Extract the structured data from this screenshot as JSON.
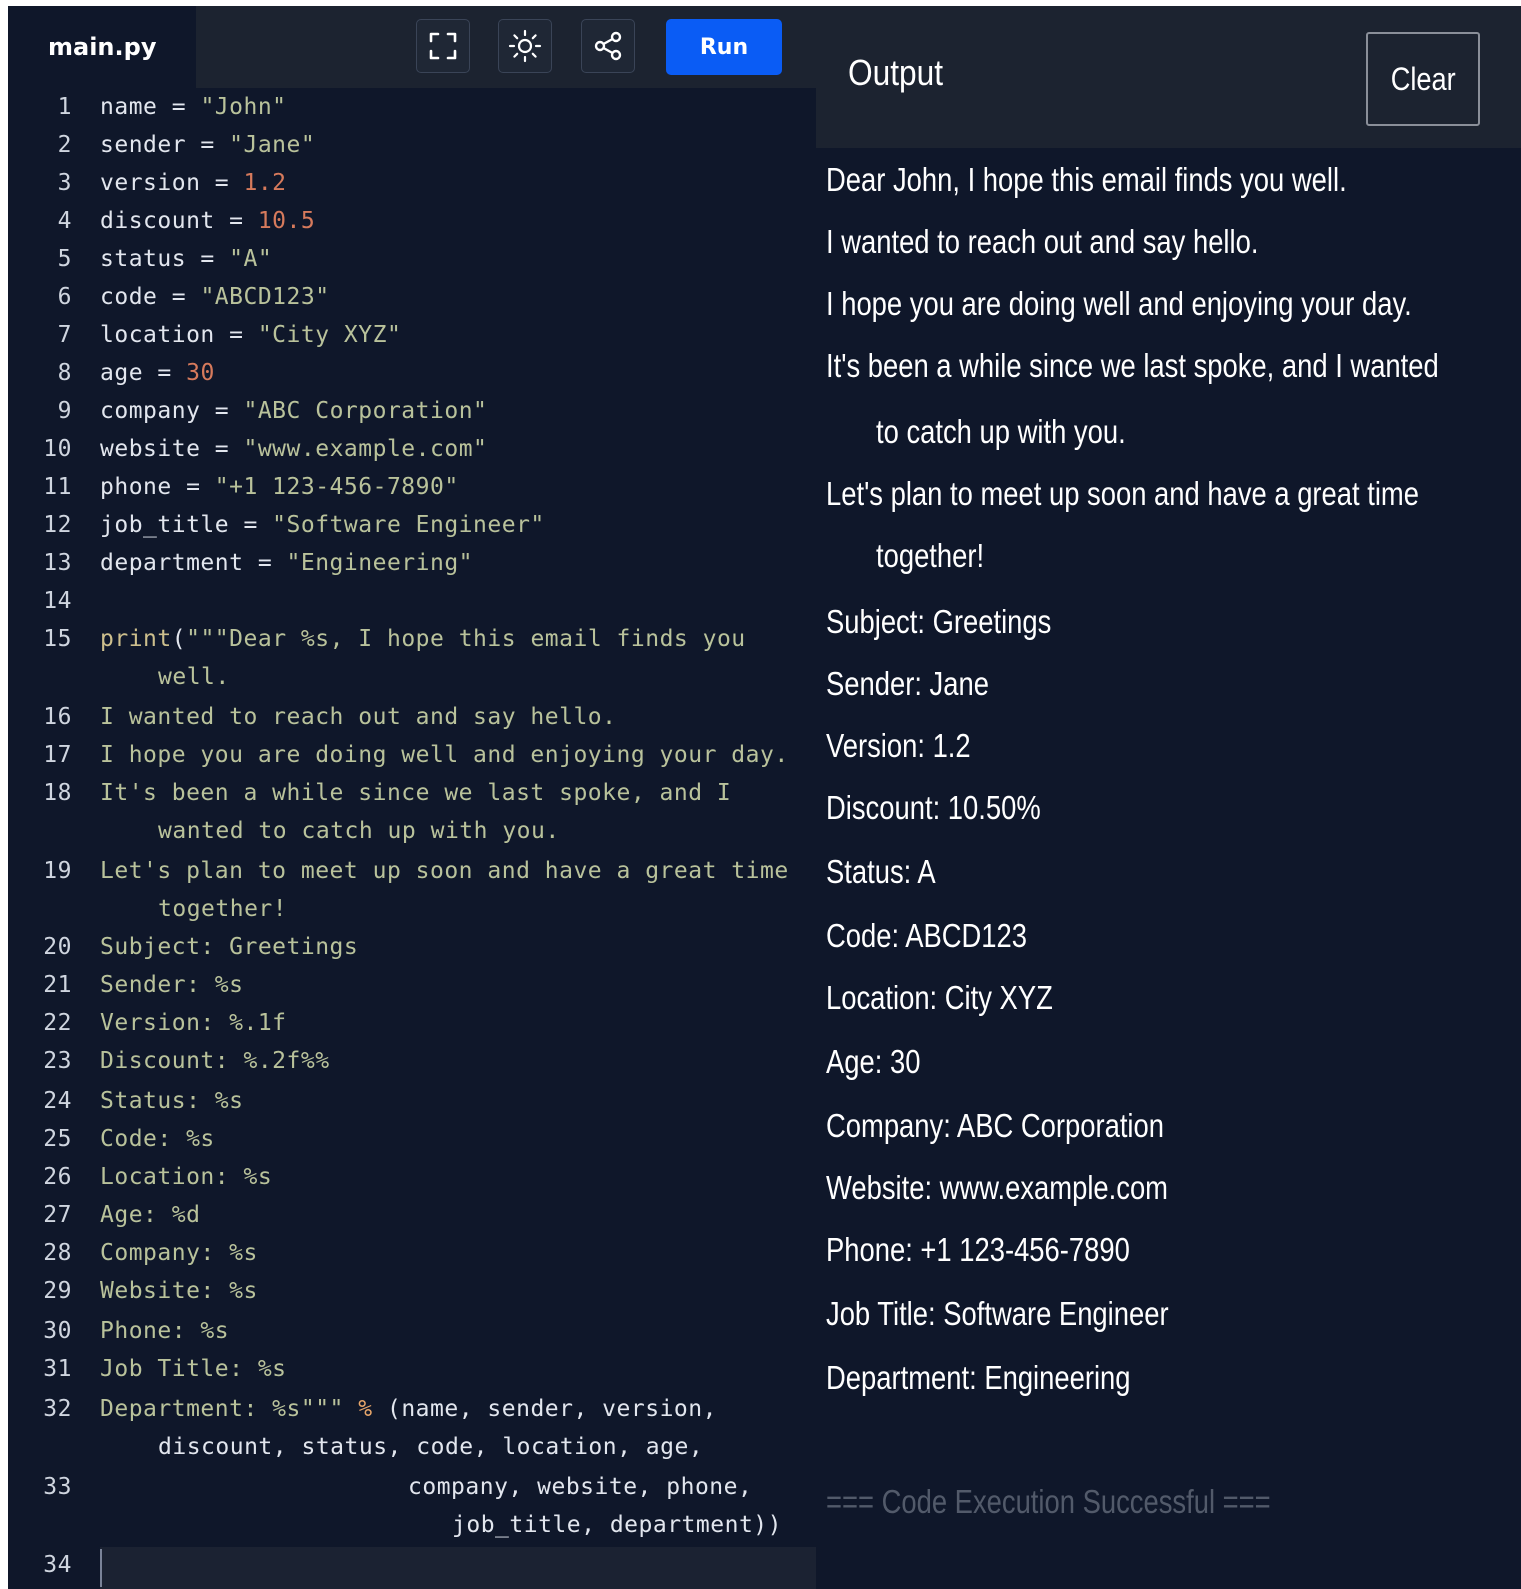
{
  "editor": {
    "file_name": "main.py",
    "toolbar": {
      "fullscreen_icon": "fullscreen-icon",
      "theme_icon": "sun-icon",
      "share_icon": "share-icon",
      "run_label": "Run"
    },
    "accent_color": "#0a5cf5",
    "lines": [
      {
        "n": "1",
        "segs": [
          [
            "",
            "name = "
          ],
          [
            "str",
            "\"John\""
          ]
        ]
      },
      {
        "n": "2",
        "segs": [
          [
            "",
            "sender = "
          ],
          [
            "str",
            "\"Jane\""
          ]
        ]
      },
      {
        "n": "3",
        "segs": [
          [
            "",
            "version = "
          ],
          [
            "num",
            "1.2"
          ]
        ]
      },
      {
        "n": "4",
        "segs": [
          [
            "",
            "discount = "
          ],
          [
            "num",
            "10.5"
          ]
        ]
      },
      {
        "n": "5",
        "segs": [
          [
            "",
            "status = "
          ],
          [
            "str",
            "\"A\""
          ]
        ]
      },
      {
        "n": "6",
        "segs": [
          [
            "",
            "code = "
          ],
          [
            "str",
            "\"ABCD123\""
          ]
        ]
      },
      {
        "n": "7",
        "segs": [
          [
            "",
            "location = "
          ],
          [
            "str",
            "\"City XYZ\""
          ]
        ]
      },
      {
        "n": "8",
        "segs": [
          [
            "",
            "age = "
          ],
          [
            "num",
            "30"
          ]
        ]
      },
      {
        "n": "9",
        "segs": [
          [
            "",
            "company = "
          ],
          [
            "str",
            "\"ABC Corporation\""
          ]
        ]
      },
      {
        "n": "10",
        "segs": [
          [
            "",
            "website = "
          ],
          [
            "str",
            "\"www.example.com\""
          ]
        ]
      },
      {
        "n": "11",
        "segs": [
          [
            "",
            "phone = "
          ],
          [
            "str",
            "\"+1 123-456-7890\""
          ]
        ]
      },
      {
        "n": "12",
        "segs": [
          [
            "",
            "job_title = "
          ],
          [
            "str",
            "\"Software Engineer\""
          ]
        ]
      },
      {
        "n": "13",
        "segs": [
          [
            "",
            "department = "
          ],
          [
            "str",
            "\"Engineering\""
          ]
        ]
      },
      {
        "n": "14",
        "segs": []
      },
      {
        "n": "15",
        "segs": [
          [
            "kw",
            "print"
          ],
          [
            "",
            "("
          ],
          [
            "str",
            "\"\"\"Dear %s, I hope this email finds you"
          ]
        ]
      },
      {
        "n": "",
        "indent": true,
        "segs": [
          [
            "str",
            "well."
          ]
        ]
      },
      {
        "n": "16",
        "segs": [
          [
            "str",
            "I wanted to reach out and say hello."
          ]
        ]
      },
      {
        "n": "17",
        "segs": [
          [
            "str",
            "I hope you are doing well and enjoying your day."
          ]
        ]
      },
      {
        "n": "18",
        "segs": [
          [
            "str",
            "It's been a while since we last spoke, and I"
          ]
        ]
      },
      {
        "n": "",
        "indent": true,
        "segs": [
          [
            "str",
            "wanted to catch up with you."
          ]
        ]
      },
      {
        "n": "19",
        "segs": [
          [
            "str",
            "Let's plan to meet up soon and have a great time"
          ]
        ]
      },
      {
        "n": "",
        "indent": true,
        "segs": [
          [
            "str",
            "together!"
          ]
        ]
      },
      {
        "n": "20",
        "segs": [
          [
            "str",
            "Subject: Greetings"
          ]
        ]
      },
      {
        "n": "21",
        "segs": [
          [
            "str",
            "Sender: %s"
          ]
        ]
      },
      {
        "n": "22",
        "segs": [
          [
            "str",
            "Version: %.1f"
          ]
        ]
      },
      {
        "n": "23",
        "segs": [
          [
            "str",
            "Discount: %.2f%%"
          ]
        ]
      },
      {
        "n": "24",
        "segs": [
          [
            "str",
            "Status: %s"
          ]
        ]
      },
      {
        "n": "25",
        "segs": [
          [
            "str",
            "Code: %s"
          ]
        ]
      },
      {
        "n": "26",
        "segs": [
          [
            "str",
            "Location: %s"
          ]
        ]
      },
      {
        "n": "27",
        "segs": [
          [
            "str",
            "Age: %d"
          ]
        ]
      },
      {
        "n": "28",
        "segs": [
          [
            "str",
            "Company: %s"
          ]
        ]
      },
      {
        "n": "29",
        "segs": [
          [
            "str",
            "Website: %s"
          ]
        ]
      },
      {
        "n": "30",
        "segs": [
          [
            "str",
            "Phone: %s"
          ]
        ]
      },
      {
        "n": "31",
        "segs": [
          [
            "str",
            "Job Title: %s"
          ]
        ]
      },
      {
        "n": "32",
        "segs": [
          [
            "str",
            "Department: %s\"\"\""
          ],
          [
            "",
            " "
          ],
          [
            "op",
            "%"
          ],
          [
            "",
            " (name, sender, version,"
          ]
        ]
      },
      {
        "n": "",
        "indent": true,
        "segs": [
          [
            "",
            "discount, status, code, location, age,"
          ]
        ]
      },
      {
        "n": "33",
        "deep": 1,
        "segs": [
          [
            "",
            "company, website, phone,"
          ]
        ]
      },
      {
        "n": "",
        "deep": 2,
        "segs": [
          [
            "",
            "job_title, department))"
          ]
        ]
      },
      {
        "n": "34",
        "segs": []
      }
    ]
  },
  "output": {
    "title": "Output",
    "clear_label": "Clear",
    "lines": [
      {
        "text": "Dear John, I hope this email finds you well."
      },
      {
        "text": "I wanted to reach out and say hello."
      },
      {
        "text": "I hope you are doing well and enjoying your day."
      },
      {
        "text": "It's been a while since we last spoke, and I wanted"
      },
      {
        "text": "to catch up with you.",
        "indent": true
      },
      {
        "text": "Let's plan to meet up soon and have a great time"
      },
      {
        "text": "together!",
        "indent": true
      },
      {
        "text": "Subject: Greetings"
      },
      {
        "text": "Sender: Jane"
      },
      {
        "text": "Version: 1.2"
      },
      {
        "text": "Discount: 10.50%"
      },
      {
        "text": "Status: A"
      },
      {
        "text": "Code: ABCD123"
      },
      {
        "text": "Location: City XYZ"
      },
      {
        "text": "Age: 30"
      },
      {
        "text": "Company: ABC Corporation"
      },
      {
        "text": "Website: www.example.com"
      },
      {
        "text": "Phone: +1 123-456-7890"
      },
      {
        "text": "Job Title: Software Engineer"
      },
      {
        "text": "Department: Engineering"
      }
    ],
    "status": "=== Code Execution Successful ==="
  }
}
